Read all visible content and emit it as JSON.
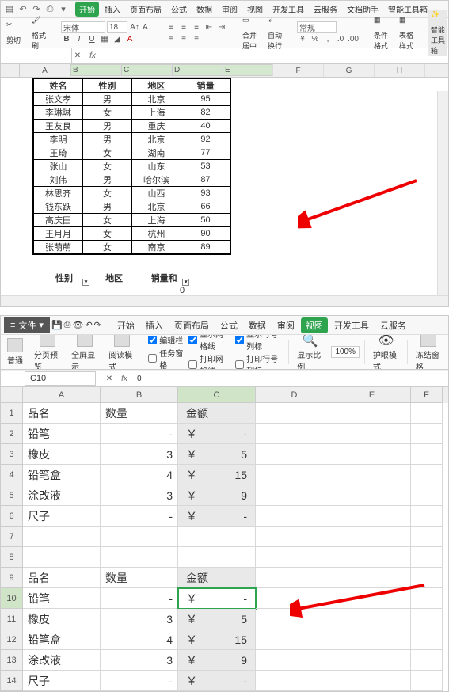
{
  "top": {
    "menus": [
      "开始",
      "插入",
      "页面布局",
      "公式",
      "数据",
      "审阅",
      "视图",
      "开发工具",
      "云服务",
      "文档助手",
      "智能工具箱"
    ],
    "active_menu": 0,
    "font_name": "宋体",
    "font_size": "18",
    "clip_label": "剪切",
    "paste_label": "格式刷",
    "merge_label": "合并居中",
    "autowrap_label": "自动换行",
    "number_fmt": "常规",
    "cond_fmt": "条件格式",
    "table_style": "表格样式",
    "smart_tool": "智能工具箱",
    "namebox": "",
    "fx_value": "",
    "cols": [
      "A",
      "B",
      "C",
      "D",
      "E",
      "F",
      "G",
      "H"
    ],
    "table": {
      "headers": [
        "姓名",
        "性别",
        "地区",
        "销量"
      ],
      "rows": [
        [
          "张文孝",
          "男",
          "北京",
          "95"
        ],
        [
          "李琳琳",
          "女",
          "上海",
          "82"
        ],
        [
          "王友良",
          "男",
          "重庆",
          "40"
        ],
        [
          "李明",
          "男",
          "北京",
          "92"
        ],
        [
          "王琦",
          "女",
          "湖南",
          "77"
        ],
        [
          "张山",
          "女",
          "山东",
          "53"
        ],
        [
          "刘伟",
          "男",
          "哈尔滨",
          "87"
        ],
        [
          "林思齐",
          "女",
          "山西",
          "93"
        ],
        [
          "钱东跃",
          "男",
          "北京",
          "66"
        ],
        [
          "高庆田",
          "女",
          "上海",
          "50"
        ],
        [
          "王月月",
          "女",
          "杭州",
          "90"
        ],
        [
          "张萌萌",
          "女",
          "南京",
          "89"
        ]
      ]
    },
    "pivot": {
      "f1": "性别",
      "f2": "地区",
      "f3": "销量和",
      "val": "0"
    }
  },
  "bottom": {
    "file_label": "文件",
    "menus": [
      "开始",
      "插入",
      "页面布局",
      "公式",
      "数据",
      "审阅",
      "视图",
      "开发工具",
      "云服务"
    ],
    "active_menu": 6,
    "view_btns": {
      "normal": "普通",
      "pgbreak": "分页预览",
      "full": "全屏显示",
      "read": "阅读模式"
    },
    "checks": {
      "editbar": "编辑栏",
      "taskpane": "任务窗格",
      "gridlines": "显示网格线",
      "printgrid": "打印网格线",
      "rowcol": "显示行号列标",
      "printrowcol": "打印行号列标"
    },
    "check_states": {
      "editbar": true,
      "taskpane": false,
      "gridlines": true,
      "printgrid": false,
      "rowcol": true,
      "printrowcol": false
    },
    "zoom_label": "显示比例",
    "zoom_pct": "100%",
    "eyecare": "护眼模式",
    "freeze": "冻结窗格",
    "namebox": "C10",
    "fx_value": "0",
    "cols": [
      "A",
      "B",
      "C",
      "D",
      "E",
      "F"
    ],
    "headers": {
      "name": "品名",
      "qty": "数量",
      "amt": "金额"
    },
    "currency": "￥",
    "items": [
      {
        "name": "铅笔",
        "qty": "-",
        "amt": "-"
      },
      {
        "name": "橡皮",
        "qty": "3",
        "amt": "5"
      },
      {
        "name": "铅笔盒",
        "qty": "4",
        "amt": "15"
      },
      {
        "name": "涂改液",
        "qty": "3",
        "amt": "9"
      },
      {
        "name": "尺子",
        "qty": "-",
        "amt": "-"
      }
    ],
    "active_cell": "C10"
  }
}
